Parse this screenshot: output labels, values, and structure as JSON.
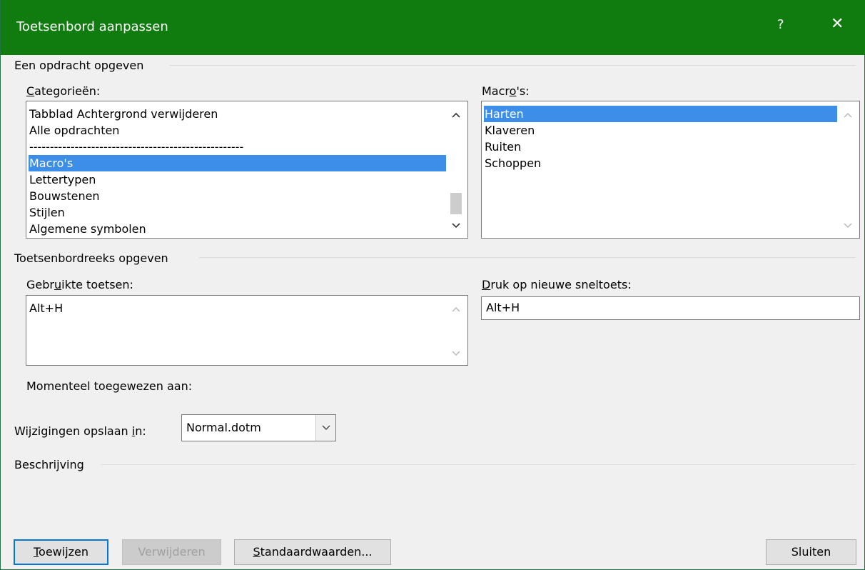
{
  "window": {
    "title": "Toetsenbord aanpassen",
    "help_label": "?",
    "close_label": "✕"
  },
  "section_command": {
    "label": "Een opdracht opgeven",
    "categories_label": {
      "mnemonic": "C",
      "rest": "ategorieën:"
    },
    "categories": [
      "Tabblad Achtergrond verwijderen",
      "Alle opdrachten",
      "----------------------------------------------------",
      "Macro's",
      "Lettertypen",
      "Bouwstenen",
      "Stijlen",
      "Algemene symbolen"
    ],
    "categories_selected_index": 3,
    "macros_label": {
      "pre": "Macr",
      "mnemonic": "o",
      "post": "'s:"
    },
    "macros": [
      "Harten",
      "Klaveren",
      "Ruiten",
      "Schoppen"
    ],
    "macros_selected_index": 0
  },
  "section_keys": {
    "label": "Toetsenbordreeks opgeven",
    "current_keys_label": {
      "pre": "Gebr",
      "mnemonic": "u",
      "post": "ikte toetsen:"
    },
    "current_keys": [
      "Alt+H"
    ],
    "new_shortcut_label": {
      "mnemonic": "D",
      "rest": "ruk op nieuwe sneltoets:"
    },
    "new_shortcut_value": "Alt+H",
    "currently_assigned_label": "Momenteel toegewezen aan:",
    "save_in_label": {
      "pre": "Wijzigingen opslaan ",
      "mnemonic": "i",
      "post": "n:"
    },
    "save_in_value": "Normal.dotm"
  },
  "section_description": {
    "label": "Beschrijving"
  },
  "buttons": {
    "assign": {
      "mnemonic": "T",
      "rest": "oewijzen"
    },
    "remove": {
      "mnemonic": "",
      "rest": "Verwijderen"
    },
    "defaults": {
      "mnemonic": "S",
      "rest": "tandaardwaarden..."
    },
    "close": "Sluiten"
  },
  "icons": {
    "scroll_up": "▲",
    "scroll_down": "▼",
    "dropdown": "chevron-down-icon"
  },
  "colors": {
    "titlebar": "#107c10",
    "selection": "#3c8ee8",
    "focus_border": "#0078d7"
  }
}
